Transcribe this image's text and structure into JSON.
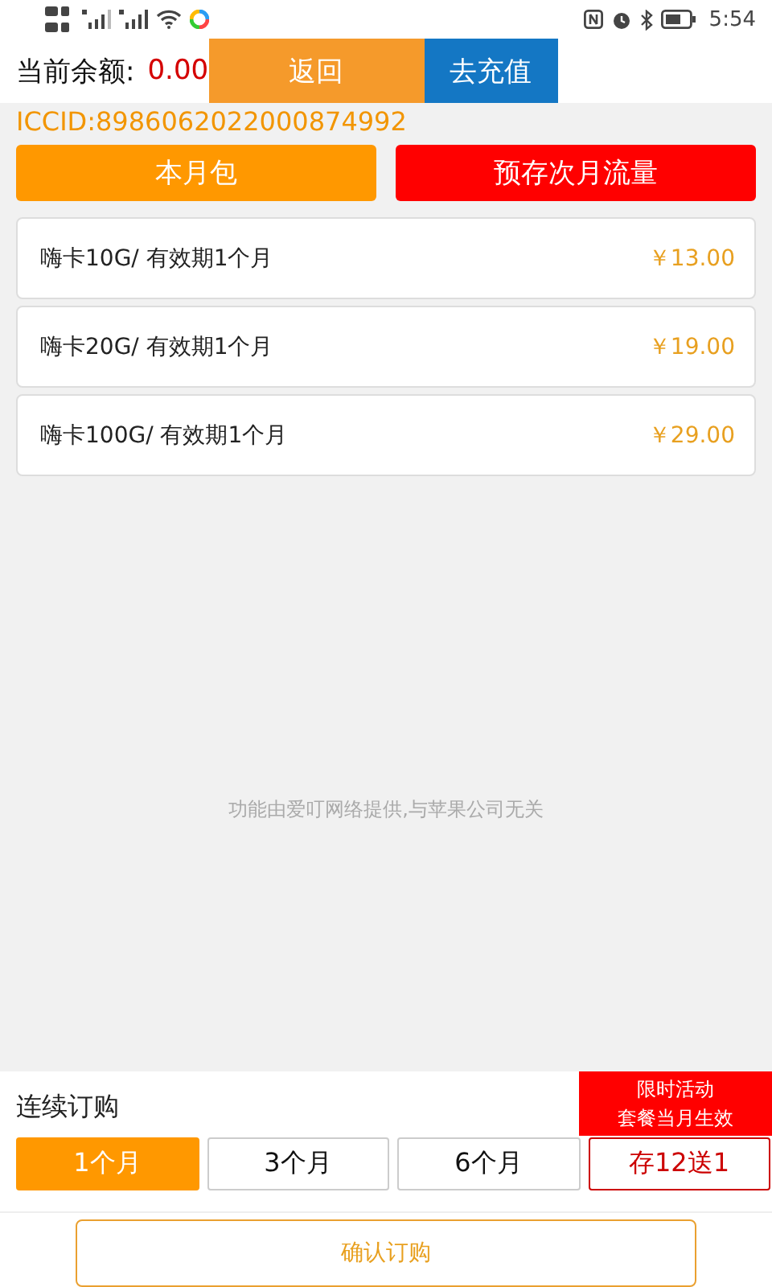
{
  "status_bar": {
    "time": "5:54"
  },
  "header": {
    "balance_label": "当前余额:",
    "balance": "0.00",
    "buttons": [
      {
        "label": "返回",
        "kind": "back"
      },
      {
        "label": "去充值",
        "kind": "recharge"
      }
    ]
  },
  "iccid": "ICCID:8986062022000874992",
  "tabs": [
    {
      "label": "本月包",
      "color": "#ff9800"
    },
    {
      "label": "预存次月流量",
      "color": "#ff0000"
    }
  ],
  "packages": [
    {
      "name": "嗨卡10G/ 有效期1个月",
      "price": "￥13.00"
    },
    {
      "name": "嗨卡20G/ 有效期1个月",
      "price": "￥19.00"
    },
    {
      "name": "嗨卡100G/ 有效期1个月",
      "price": "￥29.00"
    }
  ],
  "notice": "功能由爱叮网络提供,与苹果公司无关",
  "subscription": {
    "label": "连续订购",
    "promo": [
      "限时活动",
      "套餐当月生效"
    ],
    "options": [
      {
        "label": "1个月",
        "selected": true,
        "kind": "plain"
      },
      {
        "label": "3个月",
        "selected": false,
        "kind": "plain"
      },
      {
        "label": "6个月",
        "selected": false,
        "kind": "plain"
      },
      {
        "label": "存12送1",
        "selected": false,
        "kind": "promo"
      }
    ]
  },
  "confirm_button": "确认订购"
}
